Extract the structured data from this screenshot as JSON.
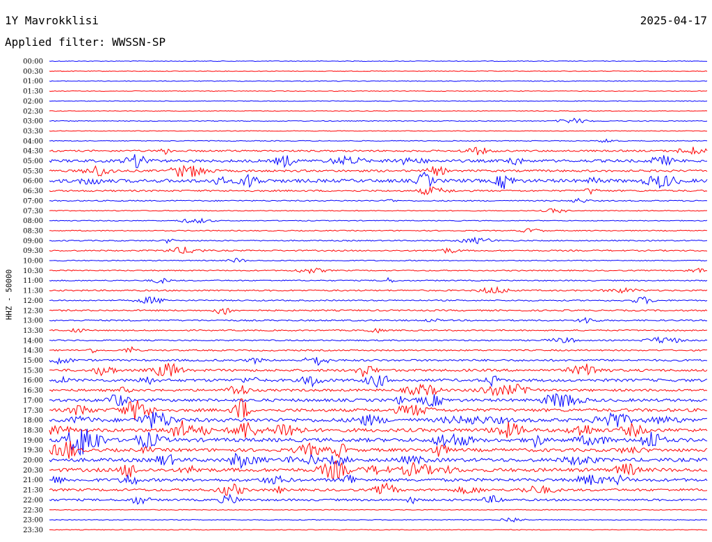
{
  "header": {
    "station": "1Y Mavrokklisi",
    "date": "2025-04-17",
    "filter": "Applied filter: WWSSN-SP"
  },
  "colors": {
    "even_line": "#0000ff",
    "odd_line": "#ff0000",
    "text": "#000000"
  },
  "chart_data": {
    "type": "line",
    "title": "1Y Mavrokklisi",
    "subtitle": "Applied filter: WWSSN-SP",
    "ylabel": "HHZ - 50000",
    "xlabel": "",
    "grid": false,
    "legend": "none",
    "row_labels": [
      "00:00",
      "00:30",
      "01:00",
      "01:30",
      "02:00",
      "02:30",
      "03:00",
      "03:30",
      "04:00",
      "04:30",
      "05:00",
      "05:30",
      "06:00",
      "06:30",
      "07:00",
      "07:30",
      "08:00",
      "08:30",
      "09:00",
      "09:30",
      "10:00",
      "10:30",
      "11:00",
      "11:30",
      "12:00",
      "12:30",
      "13:00",
      "13:30",
      "14:00",
      "14:30",
      "15:00",
      "15:30",
      "16:00",
      "16:30",
      "17:00",
      "17:30",
      "18:00",
      "18:30",
      "19:00",
      "19:30",
      "20:00",
      "20:30",
      "21:00",
      "21:30",
      "22:00",
      "22:30",
      "23:00",
      "23:30"
    ],
    "row_activity": [
      0.05,
      0.03,
      0.06,
      0.03,
      0.05,
      0.03,
      0.1,
      0.05,
      0.08,
      0.4,
      0.7,
      0.5,
      0.9,
      0.35,
      0.2,
      0.1,
      0.1,
      0.15,
      0.2,
      0.25,
      0.15,
      0.2,
      0.2,
      0.3,
      0.25,
      0.3,
      0.3,
      0.25,
      0.25,
      0.3,
      0.45,
      0.6,
      0.7,
      0.6,
      0.75,
      0.8,
      1.0,
      0.95,
      1.0,
      0.85,
      0.95,
      0.95,
      0.8,
      0.6,
      0.5,
      0.05,
      0.08,
      0.05
    ]
  }
}
